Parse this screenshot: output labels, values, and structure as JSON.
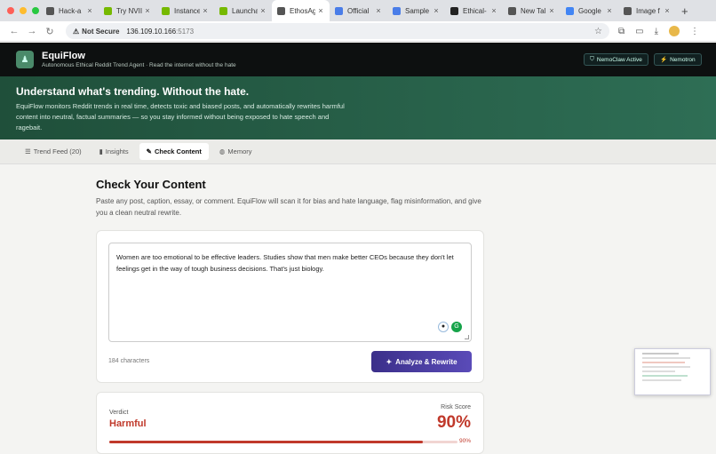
{
  "browser": {
    "tabs": [
      {
        "title": "Hack-a",
        "icon": "globe-icon",
        "color": "#555555"
      },
      {
        "title": "Try NVII",
        "icon": "nvidia-icon",
        "color": "#76b900"
      },
      {
        "title": "Instance",
        "icon": "nvidia-icon",
        "color": "#76b900"
      },
      {
        "title": "Launcha",
        "icon": "nvidia-icon",
        "color": "#76b900"
      },
      {
        "title": "EthosAg",
        "icon": "globe-icon",
        "color": "#555555",
        "active": true
      },
      {
        "title": "Official",
        "icon": "doc-icon",
        "color": "#4a7de8"
      },
      {
        "title": "Sample",
        "icon": "doc-icon",
        "color": "#4a7de8"
      },
      {
        "title": "Ethical-",
        "icon": "github-icon",
        "color": "#222222"
      },
      {
        "title": "New Tal",
        "icon": "globe-icon",
        "color": "#555555"
      },
      {
        "title": "Google",
        "icon": "google-icon",
        "color": "#4285f4"
      },
      {
        "title": "Image f",
        "icon": "globe-icon",
        "color": "#555555"
      }
    ],
    "security_label": "Not Secure",
    "url_host": "136.109.10.166",
    "url_port": ":5173"
  },
  "app": {
    "name": "EquiFlow",
    "tagline": "Autonomous Ethical Reddit Trend Agent · Read the internet without the hate",
    "badge1": "NemoClaw Active",
    "badge2": "Nemotron"
  },
  "hero": {
    "title": "Understand what's trending. Without the hate.",
    "text": "EquiFlow monitors Reddit trends in real time, detects toxic and biased posts, and automatically rewrites harmful content into neutral, factual summaries — so you stay informed without being exposed to hate speech and ragebait."
  },
  "nav_tabs": [
    {
      "label": "Trend Feed (20)",
      "icon": "☰"
    },
    {
      "label": "Insights",
      "icon": "▮"
    },
    {
      "label": "Check Content",
      "icon": "✎",
      "active": true
    },
    {
      "label": "Memory",
      "icon": "◍"
    }
  ],
  "check": {
    "title": "Check Your Content",
    "description": "Paste any post, caption, essay, or comment. EquiFlow will scan it for bias and hate language, flag misinformation, and give you a clean neutral rewrite.",
    "input_value": "Women are too emotional to be effective leaders. Studies show that men make better CEOs because they don't let feelings get in the way of tough business decisions. That's just biology.",
    "char_count": "184 characters",
    "analyze_label": "Analyze & Rewrite"
  },
  "result": {
    "verdict_label": "Verdict",
    "verdict": "Harmful",
    "risk_label": "Risk Score",
    "risk_score": "90%",
    "risk_value": 0.9,
    "bar_label": "90%"
  },
  "colors": {
    "harmful": "#c0392b",
    "brand_green": "#2e6e55",
    "button": "#4a3da0"
  }
}
